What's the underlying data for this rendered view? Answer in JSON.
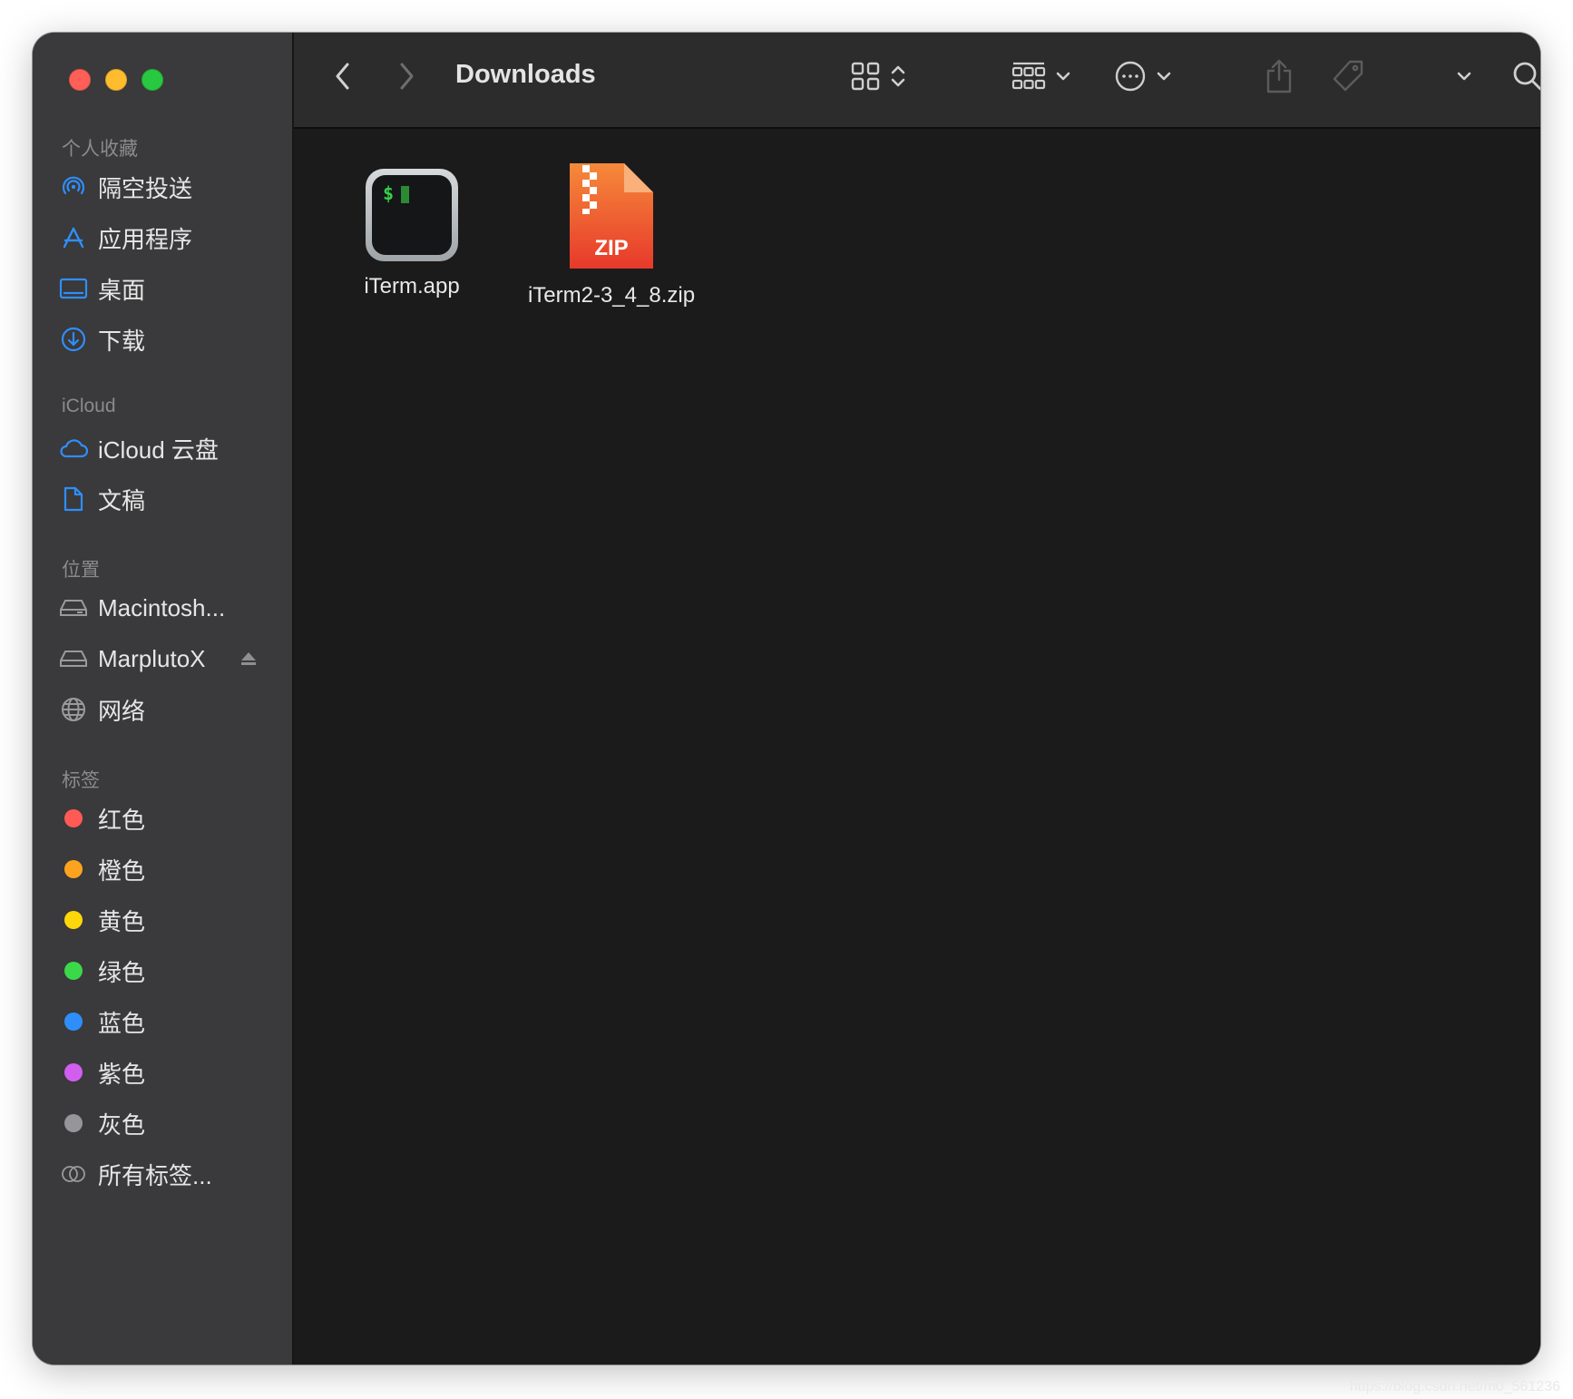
{
  "window": {
    "title": "Downloads",
    "traffic_colors": {
      "close": "#ff5f57",
      "minimize": "#febc2e",
      "zoom": "#28c840"
    }
  },
  "sidebar": {
    "favorites": {
      "title": "个人收藏",
      "items": [
        {
          "label": "隔空投送",
          "icon": "airdrop-icon"
        },
        {
          "label": "应用程序",
          "icon": "applications-icon"
        },
        {
          "label": "桌面",
          "icon": "desktop-icon"
        },
        {
          "label": "下载",
          "icon": "downloads-icon"
        }
      ]
    },
    "icloud": {
      "title": "iCloud",
      "items": [
        {
          "label": "iCloud 云盘",
          "icon": "cloud-icon"
        },
        {
          "label": "文稿",
          "icon": "document-icon"
        }
      ]
    },
    "locations": {
      "title": "位置",
      "items": [
        {
          "label": "Macintosh...",
          "icon": "drive-icon"
        },
        {
          "label": "MarplutoX",
          "icon": "drive-icon"
        },
        {
          "label": "网络",
          "icon": "network-icon"
        }
      ]
    },
    "tags": {
      "title": "标签",
      "items": [
        {
          "label": "红色",
          "color": "#ff5a55"
        },
        {
          "label": "橙色",
          "color": "#fea320"
        },
        {
          "label": "黄色",
          "color": "#fdd70a"
        },
        {
          "label": "绿色",
          "color": "#3bd84a"
        },
        {
          "label": "蓝色",
          "color": "#2f8efb"
        },
        {
          "label": "紫色",
          "color": "#d25ef0"
        },
        {
          "label": "灰色",
          "color": "#96959a"
        },
        {
          "label": "所有标签...",
          "icon": "all-tags-icon"
        }
      ]
    }
  },
  "files": [
    {
      "name": "iTerm.app",
      "kind": "app"
    },
    {
      "name": "iTerm2-3_4_8.zip",
      "kind": "zip",
      "badge": "ZIP"
    }
  ],
  "terminal_prompt": "$",
  "watermark": "https://blog.csdn.net/m0_561236"
}
